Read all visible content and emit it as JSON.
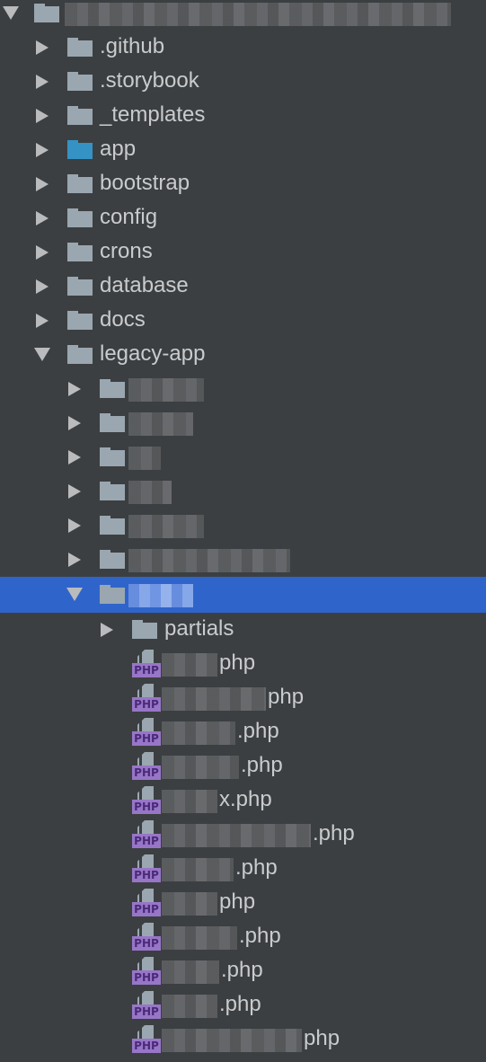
{
  "colors": {
    "background": "#3c3f41",
    "selection": "#2f65ca",
    "folder": "#9aa7b0",
    "source_folder": "#3592c4",
    "text": "#c9cbcd",
    "php_badge": "#9876c7"
  },
  "tree": {
    "root": {
      "label": "[redacted]",
      "expanded": true
    },
    "items": [
      {
        "label": ".github",
        "type": "folder",
        "expanded": false
      },
      {
        "label": ".storybook",
        "type": "folder",
        "expanded": false
      },
      {
        "label": "_templates",
        "type": "folder",
        "expanded": false
      },
      {
        "label": "app",
        "type": "source-folder",
        "expanded": false
      },
      {
        "label": "bootstrap",
        "type": "folder",
        "expanded": false
      },
      {
        "label": "config",
        "type": "folder",
        "expanded": false
      },
      {
        "label": "crons",
        "type": "folder",
        "expanded": false
      },
      {
        "label": "database",
        "type": "folder",
        "expanded": false
      },
      {
        "label": "docs",
        "type": "folder",
        "expanded": false
      },
      {
        "label": "legacy-app",
        "type": "folder",
        "expanded": true
      }
    ],
    "legacy_children": [
      {
        "label": "[redacted]",
        "type": "folder",
        "expanded": false
      },
      {
        "label": "[redacted]",
        "type": "folder",
        "expanded": false
      },
      {
        "label": "[redacted]",
        "type": "folder",
        "expanded": false
      },
      {
        "label": "[redacted]",
        "type": "folder",
        "expanded": false
      },
      {
        "label": "[redacted]",
        "type": "folder",
        "expanded": false
      },
      {
        "label": "[redacted]",
        "type": "folder",
        "expanded": false
      },
      {
        "label": "[redacted]",
        "type": "folder",
        "expanded": true,
        "selected": true
      }
    ],
    "selected_children": {
      "partials": {
        "label": "partials",
        "type": "folder",
        "expanded": false
      },
      "php_badge": "PHP",
      "files": [
        {
          "suffix": "php"
        },
        {
          "suffix": "php"
        },
        {
          "suffix": ".php"
        },
        {
          "suffix": ".php"
        },
        {
          "suffix": "x.php"
        },
        {
          "suffix": ".php"
        },
        {
          "suffix": ".php"
        },
        {
          "suffix": "php"
        },
        {
          "suffix": ".php"
        },
        {
          "suffix": ".php"
        },
        {
          "suffix": ".php"
        },
        {
          "suffix": "php"
        }
      ]
    }
  }
}
